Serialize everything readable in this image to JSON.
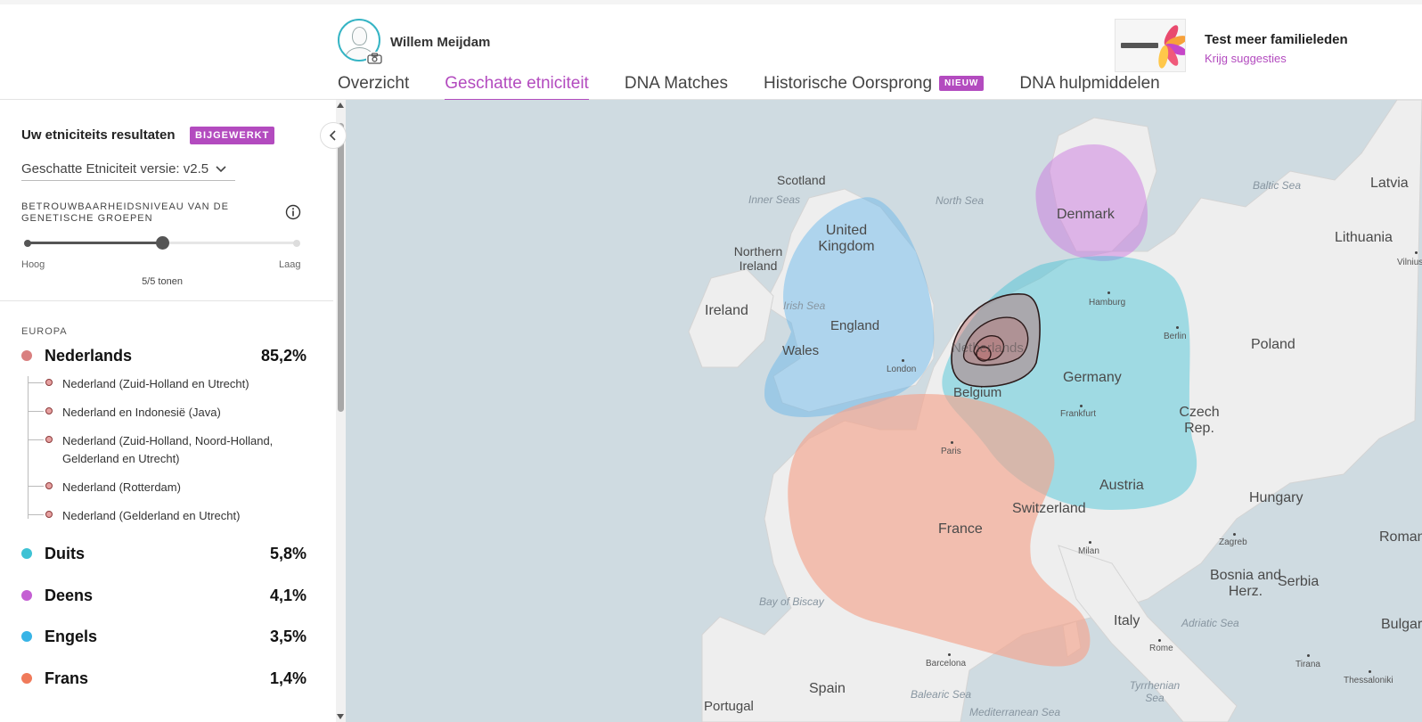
{
  "header": {
    "user_name": "Willem Meijdam",
    "tabs": [
      {
        "label": "Overzicht",
        "active": false
      },
      {
        "label": "Geschatte etniciteit",
        "active": true
      },
      {
        "label": "DNA Matches",
        "active": false
      },
      {
        "label": "Historische Oorsprong",
        "active": false,
        "badge": "NIEUW"
      },
      {
        "label": "DNA hulpmiddelen",
        "active": false
      }
    ],
    "promo": {
      "title": "Test meer familieleden",
      "link": "Krijg suggesties"
    }
  },
  "sidebar": {
    "title": "Uw etniciteits resultaten",
    "title_badge": "BIJGEWERKT",
    "version_select": "Geschatte Etniciteit versie: v2.5",
    "confidence_label": "BETROUWBAARHEIDSNIVEAU VAN DE GENETISCHE GROEPEN",
    "slider": {
      "low_label": "Hoog",
      "high_label": "Laag",
      "value_fraction": 0.5,
      "status": "5/5 tonen"
    },
    "region_heading": "EUROPA",
    "ethnicities": [
      {
        "name": "Nederlands",
        "percent": "85,2%",
        "color": "#d98080"
      },
      {
        "name": "Duits",
        "percent": "5,8%",
        "color": "#3ec2d4"
      },
      {
        "name": "Deens",
        "percent": "4,1%",
        "color": "#c45fd3"
      },
      {
        "name": "Engels",
        "percent": "3,5%",
        "color": "#38b4e6"
      },
      {
        "name": "Frans",
        "percent": "1,4%",
        "color": "#f07a5a"
      }
    ],
    "sub_regions": [
      "Nederland (Zuid-Holland en Utrecht)",
      "Nederland en Indonesië (Java)",
      "Nederland (Zuid-Holland, Noord-Holland, Gelderland en Utrecht)",
      "Nederland (Rotterdam)",
      "Nederland (Gelderland en Utrecht)"
    ]
  },
  "map": {
    "countries": [
      "Scotland",
      "United Kingdom",
      "Northern Ireland",
      "Ireland",
      "England",
      "Wales",
      "Denmark",
      "Germany",
      "Belgium",
      "Netherlands",
      "France",
      "Switzerland",
      "Austria",
      "Czech Rep.",
      "Poland",
      "Lithuania",
      "Latvia",
      "Hungary",
      "Romania",
      "Serbia",
      "Bosnia and Herz.",
      "Bulgaria",
      "Italy",
      "Spain",
      "Portugal"
    ],
    "seas": [
      "Inner Seas",
      "North Sea",
      "Baltic Sea",
      "Irish Sea",
      "Bay of Biscay",
      "Adriatic Sea",
      "Tyrrhenian Sea",
      "Balearic Sea",
      "Mediterranean Sea"
    ],
    "cities": [
      "Hamburg",
      "Berlin",
      "London",
      "Frankfurt",
      "Paris",
      "Milan",
      "Zagreb",
      "Rome",
      "Barcelona",
      "Tirana",
      "Thessaloniki",
      "Vilnius"
    ]
  }
}
